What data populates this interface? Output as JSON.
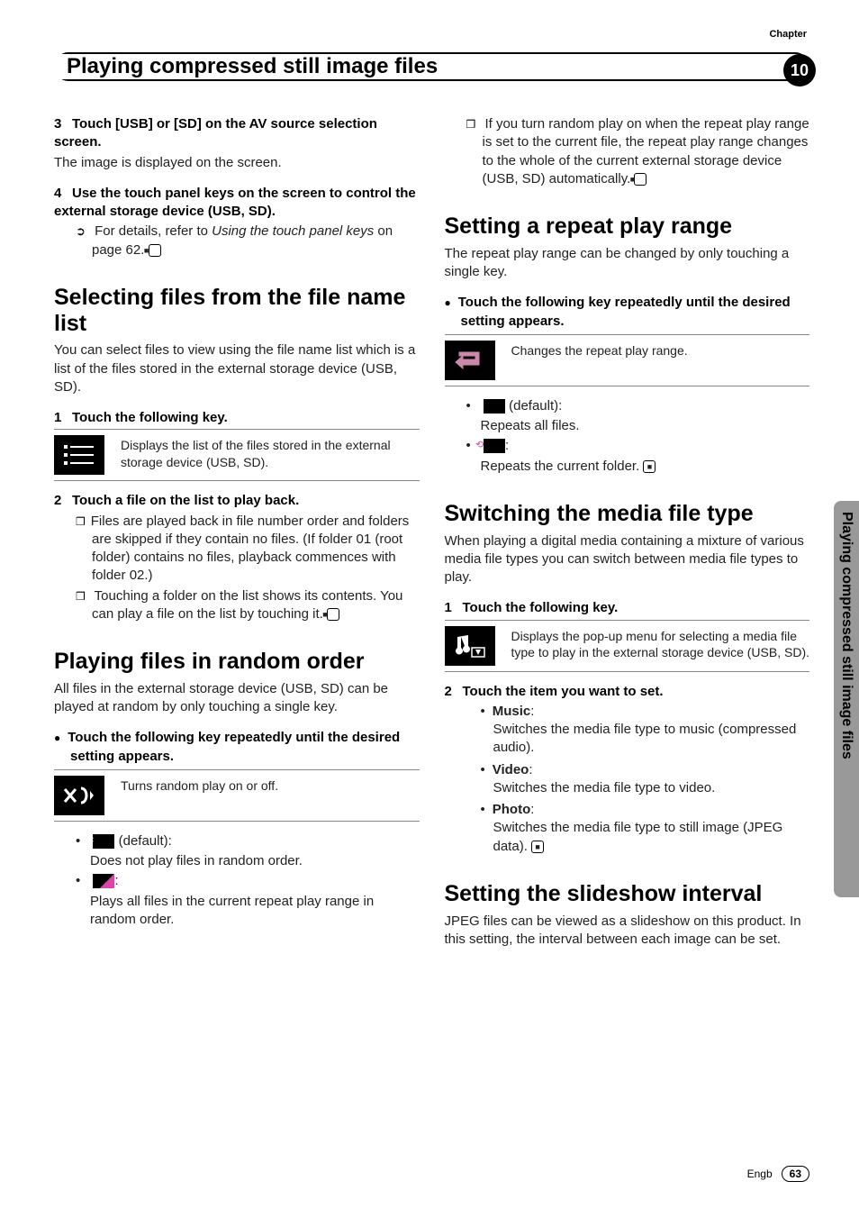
{
  "chapter_label": "Chapter",
  "chapter_number": "10",
  "header_title": "Playing compressed still image files",
  "side_tab": "Playing compressed still image files",
  "footer_lang": "Engb",
  "footer_page": "63",
  "left": {
    "step3_heading": "Touch [USB] or [SD] on the AV source selection screen.",
    "step3_num": "3",
    "step3_body": "The image is displayed on the screen.",
    "step4_heading": "Use the touch panel keys on the screen to control the external storage device (USB, SD).",
    "step4_num": "4",
    "step4_detail_pre": "For details, refer to ",
    "step4_detail_em": "Using the touch panel keys",
    "step4_detail_post": " on page 62.",
    "sec1_title": "Selecting files from the file name list",
    "sec1_intro": "You can select files to view using the file name list which is a list of the files stored in the external storage device (USB, SD).",
    "sec1_step1_num": "1",
    "sec1_step1_heading": "Touch the following key.",
    "sec1_key_desc": "Displays the list of the files stored in the external storage device (USB, SD).",
    "sec1_step2_num": "2",
    "sec1_step2_heading": "Touch a file on the list to play back.",
    "sec1_note1": "Files are played back in file number order and folders are skipped if they contain no files. (If folder 01 (root folder) contains no files, playback commences with folder 02.)",
    "sec1_note2": "Touching a folder on the list shows its contents. You can play a file on the list by touching it.",
    "sec2_title": "Playing files in random order",
    "sec2_intro": "All files in the external storage device (USB, SD) can be played at random by only touching a single key.",
    "sec2_action": "Touch the following key repeatedly until the desired setting appears.",
    "sec2_key_desc": "Turns random play on or off.",
    "sec2_opt1_label": " (default):",
    "sec2_opt1_desc": "Does not play files in random order.",
    "sec2_opt2_label": ":",
    "sec2_opt2_desc": "Plays all files in the current repeat play range in random order."
  },
  "right": {
    "carry_note": "If you turn random play on when the repeat play range is set to the current file, the repeat play range changes to the whole of the current external storage device (USB, SD) automatically.",
    "sec3_title": "Setting a repeat play range",
    "sec3_intro": "The repeat play range can be changed by only touching a single key.",
    "sec3_action": "Touch the following key repeatedly until the desired setting appears.",
    "sec3_key_desc": "Changes the repeat play range.",
    "sec3_opt1_label": " (default):",
    "sec3_opt1_desc": "Repeats all files.",
    "sec3_opt2_label": ":",
    "sec3_opt2_desc": "Repeats the current folder.",
    "sec4_title": "Switching the media file type",
    "sec4_intro": "When playing a digital media containing a mixture of various media file types you can switch between media file types to play.",
    "sec4_step1_num": "1",
    "sec4_step1_heading": "Touch the following key.",
    "sec4_key_desc": "Displays the pop-up menu for selecting a media file type to play in the external storage device (USB, SD).",
    "sec4_step2_num": "2",
    "sec4_step2_heading": "Touch the item you want to set.",
    "sec4_item1_label": "Music",
    "sec4_item1_desc": "Switches the media file type to music (compressed audio).",
    "sec4_item2_label": "Video",
    "sec4_item2_desc": "Switches the media file type to video.",
    "sec4_item3_label": "Photo",
    "sec4_item3_desc": "Switches the media file type to still image (JPEG data).",
    "sec5_title": "Setting the slideshow interval",
    "sec5_intro": "JPEG files can be viewed as a slideshow on this product. In this setting, the interval between each image can be set."
  }
}
